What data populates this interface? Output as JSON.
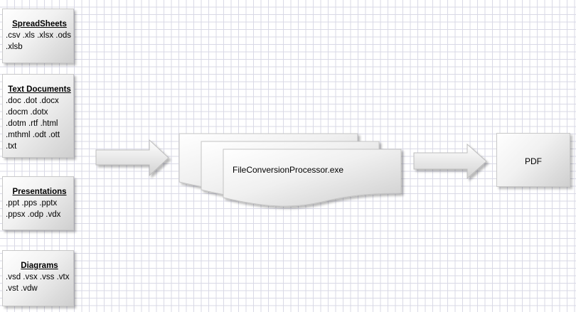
{
  "diagram": {
    "inputs": [
      {
        "title": "SpreadSheets",
        "lines": [
          ".csv .xls .xlsx .ods",
          ".xlsb"
        ]
      },
      {
        "title": "Text Documents",
        "lines": [
          ".doc .dot .docx",
          ".docm .dotx",
          ".dotm .rtf .html",
          ".mthml .odt .ott",
          ".txt"
        ]
      },
      {
        "title": "Presentations",
        "lines": [
          ".ppt .pps .pptx",
          ".ppsx .odp .vdx"
        ]
      },
      {
        "title": "Diagrams",
        "lines": [
          ".vsd .vsx .vss .vtx",
          ".vst .vdw"
        ]
      }
    ],
    "processor": {
      "label": "FileConversionProcessor.exe"
    },
    "output": {
      "label": "PDF"
    },
    "colors": {
      "grid": "#d9d9e6",
      "shape_fill_light": "#ffffff",
      "shape_fill_dark": "#cfcfcf",
      "shape_border": "#c8c8c8"
    }
  }
}
